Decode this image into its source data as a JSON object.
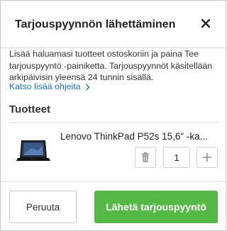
{
  "dialog": {
    "title": "Tarjouspyynnön lähettäminen",
    "description": "Lisää haluamasi tuotteet ostoskoriin ja paina Tee tarjouspyyntö -painiketta. Tarjouspyynnöt käsitellään arkipäivisin yleensä 24 tunnin sisällä.",
    "help_link": "Katso lisää ohjeita"
  },
  "products": {
    "heading": "Tuotteet",
    "items": [
      {
        "name": "Lenovo ThinkPad P52s 15,6\" -ka...",
        "quantity": "1"
      }
    ]
  },
  "footer": {
    "cancel_label": "Peruuta",
    "submit_label": "Lähetä tarjouspyyntö"
  },
  "colors": {
    "accent_green": "#55b946",
    "link_blue": "#1a73c8"
  },
  "icons": {
    "close": "close-icon",
    "chevron": "chevron-right-icon",
    "trash": "trash-icon",
    "plus": "plus-icon"
  }
}
